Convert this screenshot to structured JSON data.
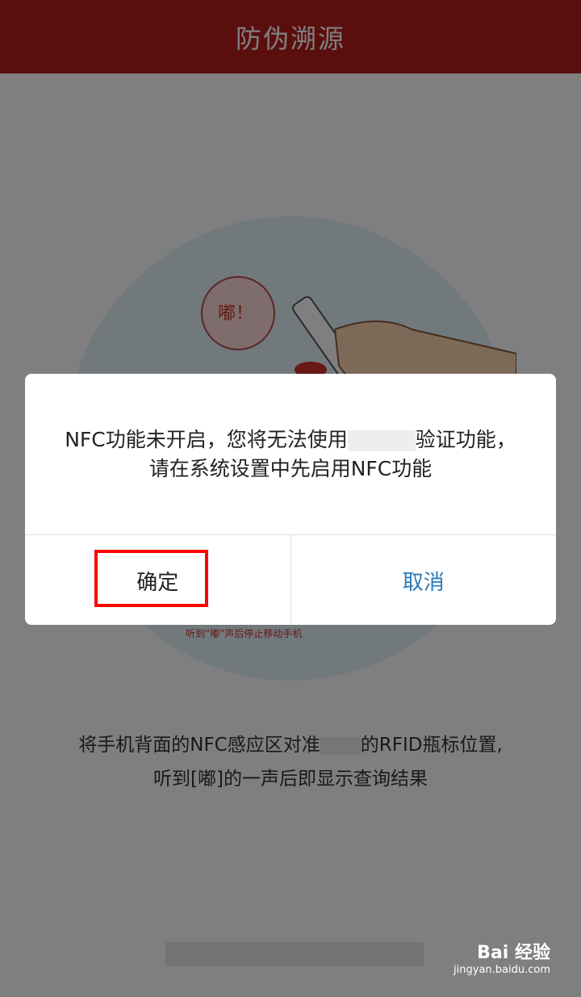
{
  "header": {
    "title": "防伪溯源"
  },
  "illustration": {
    "bubble_text": "嘟！",
    "hint": "听到“嘟”声后停止移动手机"
  },
  "instructions": {
    "line1_a": "将手机背面的NFC感应区对准",
    "line1_b": "的RFID瓶标位置,",
    "line2": "听到[嘟]的一声后即显示查询结果"
  },
  "dialog": {
    "message_a": "NFC功能未开启，您将无法使用",
    "message_b": "验证功能，请在系统设置中先启用NFC功能",
    "confirm_label": "确定",
    "cancel_label": "取消"
  },
  "watermark": {
    "brand": "Bai 经验",
    "url": "jingyan.baidu.com"
  }
}
